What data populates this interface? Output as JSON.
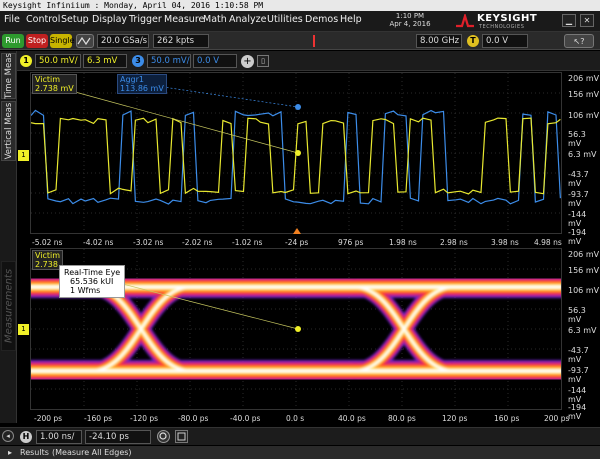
{
  "titlebar": {
    "text": "Keysight Infiniium : Monday, April 04, 2016 1:10:58 PM"
  },
  "menu": [
    "File",
    "Control",
    "Setup",
    "Display",
    "Trigger",
    "Measure",
    "Math",
    "Analyze",
    "Utilities",
    "Demos",
    "Help"
  ],
  "clock": {
    "time": "1:10 PM",
    "date": "Apr 4, 2016"
  },
  "brand": {
    "name": "KEYSIGHT",
    "sub": "TECHNOLOGIES"
  },
  "toolbar": {
    "run": "Run",
    "stop": "Stop",
    "single": "Single",
    "sample_rate": "20.0 GSa/s",
    "memory_depth": "262 kpts",
    "bandwidth": "8.00 GHz",
    "trigger_level": "0.0 V",
    "trigger_badge": "T"
  },
  "channels": {
    "ch1_badge": "1",
    "ch1_scale": "50.0 mV/",
    "ch1_offset": "6.3 mV",
    "ch3_badge": "3",
    "ch3_scale": "50.0 mV/",
    "ch3_offset": "0.0 V"
  },
  "lefttabs": {
    "time_meas": "Time Meas",
    "vertical_meas": "Vertical Meas",
    "measurements": "Measurements"
  },
  "upper": {
    "victim_label": "Victim",
    "victim_value": "2.738 mV",
    "aggr_label": "Aggr1",
    "aggr_value": "113.86 mV",
    "y_ticks": [
      "206 mV",
      "156 mV",
      "106 mV",
      "56.3 mV",
      "6.3 mV",
      "-43.7 mV",
      "-93.7 mV",
      "-144 mV",
      "-194 mV"
    ],
    "x_ticks": [
      "-5.02 ns",
      "-4.02 ns",
      "-3.02 ns",
      "-2.02 ns",
      "-1.02 ns",
      "-24 ps",
      "976 ps",
      "1.98 ns",
      "2.98 ns",
      "3.98 ns",
      "4.98 ns"
    ]
  },
  "lower": {
    "victim_label": "Victim",
    "victim_value": "2.738",
    "eye_title": "Real-Time Eye",
    "eye_ui": "65.536 kUI",
    "eye_wfms": "1 Wfms",
    "y_ticks": [
      "206 mV",
      "156 mV",
      "106 mV",
      "56.3 mV",
      "6.3 mV",
      "-43.7 mV",
      "-93.7 mV",
      "-144 mV",
      "-194 mV"
    ],
    "x_ticks": [
      "-200 ps",
      "-160 ps",
      "-120 ps",
      "-80.0 ps",
      "-40.0 ps",
      "0.0 s",
      "40.0 ps",
      "80.0 ps",
      "120 ps",
      "160 ps",
      "200 ps"
    ]
  },
  "horizontal": {
    "badge": "H",
    "scale": "1.00 ns/",
    "position": "-24.10 ps"
  },
  "results": {
    "label": "Results",
    "mode": "(Measure All Edges)"
  },
  "colors": {
    "ch1": "#f0f028",
    "ch3": "#3c8ce8",
    "run_green": "#2e9a2e",
    "stop_red": "#c02020",
    "single_yellow": "#c8b400"
  }
}
